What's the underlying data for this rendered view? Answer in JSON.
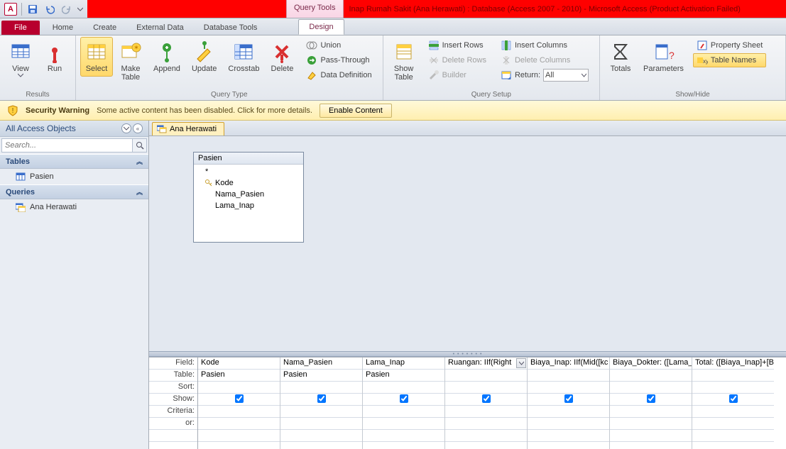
{
  "titlebar": {
    "query_tools": "Query Tools",
    "title": "Inap Rumah Sakit (Ana Herawati) : Database (Access 2007 - 2010) - Microsoft Access (Product Activation Failed)"
  },
  "tabs": {
    "file": "File",
    "home": "Home",
    "create": "Create",
    "external_data": "External Data",
    "database_tools": "Database Tools",
    "design": "Design"
  },
  "ribbon": {
    "results": {
      "label": "Results",
      "view": "View",
      "run": "Run"
    },
    "query_type": {
      "label": "Query Type",
      "select": "Select",
      "make_table": "Make\nTable",
      "append": "Append",
      "update": "Update",
      "crosstab": "Crosstab",
      "delete": "Delete",
      "union": "Union",
      "pass_through": "Pass-Through",
      "data_definition": "Data Definition"
    },
    "query_setup": {
      "label": "Query Setup",
      "show_table": "Show\nTable",
      "insert_rows": "Insert Rows",
      "delete_rows": "Delete Rows",
      "builder": "Builder",
      "insert_columns": "Insert Columns",
      "delete_columns": "Delete Columns",
      "return": "Return:",
      "return_value": "All"
    },
    "show_hide": {
      "label": "Show/Hide",
      "totals": "Totals",
      "parameters": "Parameters",
      "property_sheet": "Property Sheet",
      "table_names": "Table Names"
    }
  },
  "security": {
    "title": "Security Warning",
    "message": "Some active content has been disabled. Click for more details.",
    "enable": "Enable Content"
  },
  "nav": {
    "header": "All Access Objects",
    "search_placeholder": "Search...",
    "tables_hdr": "Tables",
    "queries_hdr": "Queries",
    "table_item": "Pasien",
    "query_item": "Ana Herawati"
  },
  "doc": {
    "tab_name": "Ana Herawati",
    "table_box": {
      "title": "Pasien",
      "star": "*",
      "fields": [
        "Kode",
        "Nama_Pasien",
        "Lama_Inap"
      ]
    }
  },
  "grid": {
    "labels": {
      "field": "Field:",
      "table": "Table:",
      "sort": "Sort:",
      "show": "Show:",
      "criteria": "Criteria:",
      "or": "or:"
    },
    "columns": [
      {
        "field": "Kode",
        "table": "Pasien",
        "show": true,
        "active": false
      },
      {
        "field": "Nama_Pasien",
        "table": "Pasien",
        "show": true,
        "active": false
      },
      {
        "field": "Lama_Inap",
        "table": "Pasien",
        "show": true,
        "active": false
      },
      {
        "field": "Ruangan: IIf(Right",
        "table": "",
        "show": true,
        "active": true
      },
      {
        "field": "Biaya_Inap: IIf(Mid([kc",
        "table": "",
        "show": true,
        "active": false
      },
      {
        "field": "Biaya_Dokter: ([Lama_",
        "table": "",
        "show": true,
        "active": false
      },
      {
        "field": "Total: ([Biaya_Inap]+[B",
        "table": "",
        "show": true,
        "active": false
      }
    ]
  }
}
